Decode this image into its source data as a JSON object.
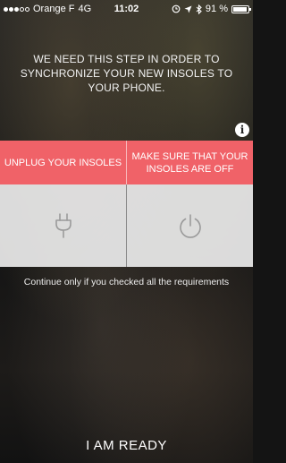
{
  "status_bar": {
    "signal_strength": 3,
    "signal_total": 5,
    "carrier": "Orange F",
    "network": "4G",
    "time": "11:02",
    "battery_percent": "91 %",
    "battery_level": 0.91
  },
  "intro_text": "WE NEED THIS STEP IN ORDER TO SYNCHRONIZE YOUR NEW INSOLES TO YOUR PHONE.",
  "info_icon": "i",
  "requirements": [
    {
      "label": "UNPLUG YOUR INSOLES",
      "icon": "plug-icon"
    },
    {
      "label": "MAKE SURE THAT YOUR INSOLES ARE OFF",
      "icon": "power-icon"
    }
  ],
  "continue_text": "Continue only if you checked all the requirements",
  "ready_button_label": "I AM READY",
  "colors": {
    "accent": "#f06268",
    "card_bg": "#ebebeb",
    "icon_stroke": "#9a9a9a"
  }
}
